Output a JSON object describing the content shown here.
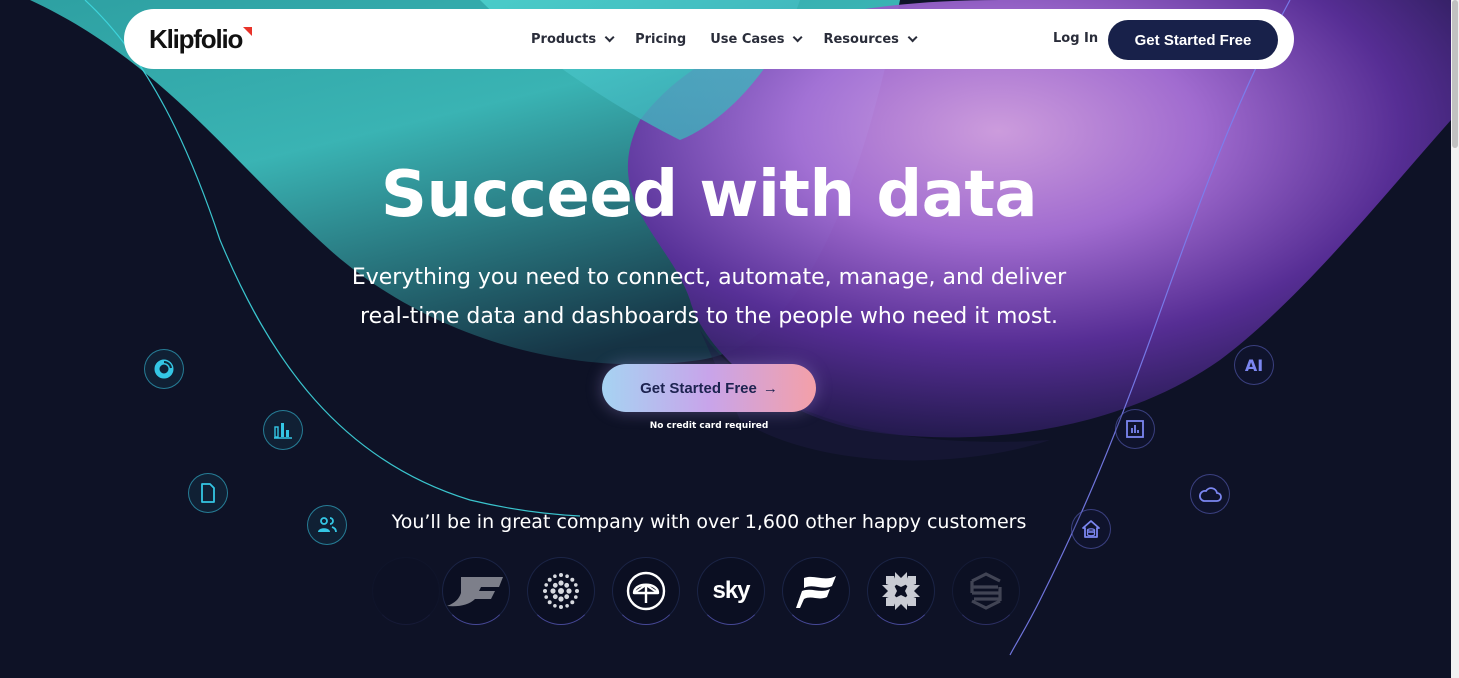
{
  "nav": {
    "logo": "Klipfolio",
    "menu": [
      {
        "label": "Products",
        "has_dropdown": true
      },
      {
        "label": "Pricing",
        "has_dropdown": false
      },
      {
        "label": "Use Cases",
        "has_dropdown": true
      },
      {
        "label": "Resources",
        "has_dropdown": true
      }
    ],
    "login_label": "Log In",
    "cta_label": "Get Started Free"
  },
  "hero": {
    "title": "Succeed with data",
    "subtitle_line1": "Everything you need to connect, automate, manage, and deliver",
    "subtitle_line2": "real-time data and dashboards to the people who need it most.",
    "cta_label": "Get Started Free",
    "cta_arrow": "→",
    "cta_note": "No credit card required"
  },
  "floating_icons": {
    "left": [
      "donut-chart-icon",
      "bar-chart-icon",
      "document-icon",
      "users-icon"
    ],
    "right": [
      "ai-badge",
      "report-chart-icon",
      "cloud-icon",
      "data-warehouse-icon"
    ],
    "ai_label": "AI"
  },
  "customers": {
    "heading": "You’ll be in great company with over 1,600 other happy customers",
    "logos": [
      "f-wing-logo",
      "dotted-sphere-logo",
      "umbrella-logo",
      "sky-logo",
      "wave-f-logo",
      "starburst-logo",
      "stripe-hexagon-logo"
    ],
    "sky_text": "sky"
  },
  "colors": {
    "background": "#0e1226",
    "nav_cta": "#18214a",
    "teal": "#3fc3c0",
    "violet": "#7b86f0",
    "cyan_icon": "#34c6e4",
    "logo_accent": "#e8332a"
  }
}
